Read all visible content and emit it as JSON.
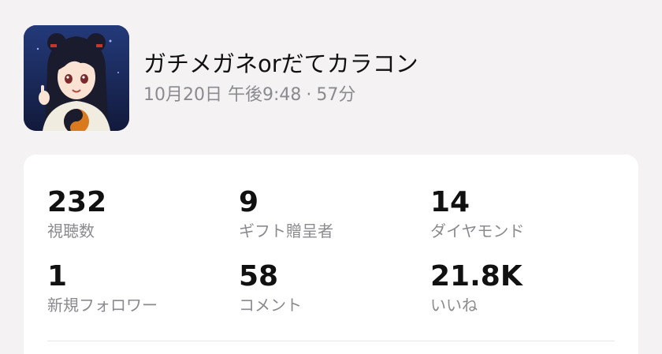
{
  "stream": {
    "title": "ガチメガネorだてカラコン",
    "date_time": "10月20日 午後9:48",
    "separator": "·",
    "duration": "57分"
  },
  "stats": [
    {
      "value": "232",
      "label": "視聴数"
    },
    {
      "value": "9",
      "label": "ギフト贈呈者"
    },
    {
      "value": "14",
      "label": "ダイヤモンド"
    },
    {
      "value": "1",
      "label": "新規フォロワー"
    },
    {
      "value": "58",
      "label": "コメント"
    },
    {
      "value": "21.8K",
      "label": "いいね"
    }
  ]
}
